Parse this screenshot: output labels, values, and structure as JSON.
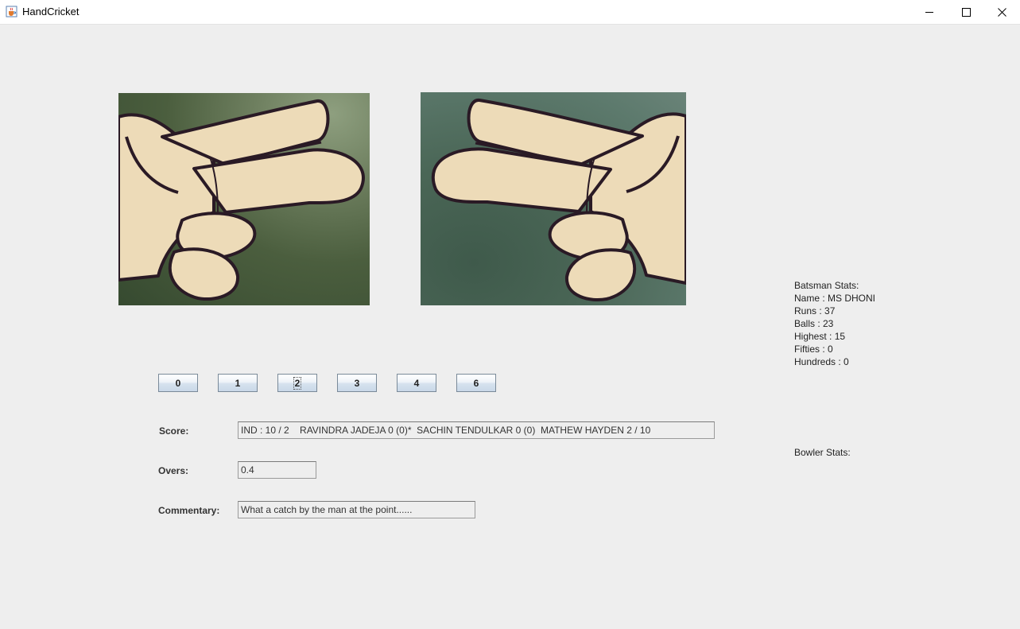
{
  "window": {
    "title": "HandCricket",
    "icon": "java-cup-icon"
  },
  "buttons": [
    "0",
    "1",
    "2",
    "3",
    "4",
    "6"
  ],
  "focused_button": "2",
  "labels": {
    "score": "Score:",
    "overs": "Overs:",
    "commentary": "Commentary:"
  },
  "fields": {
    "score": "IND : 10 / 2    RAVINDRA JADEJA 0 (0)*  SACHIN TENDULKAR 0 (0)  MATHEW HAYDEN 2 / 10",
    "overs": "0.4",
    "commentary": "What a catch by the man at the point......"
  },
  "batsman_stats": {
    "heading": "Batsman Stats:",
    "name": "Name : MS DHONI",
    "runs": "Runs : 37",
    "balls": "Balls : 23",
    "highest": "Highest : 15",
    "fifties": "Fifties : 0",
    "hundreds": "Hundreds : 0"
  },
  "bowler_stats": {
    "heading": "Bowler Stats:"
  },
  "images": {
    "left_hand": "hand-showing-two-fingers",
    "right_hand": "hand-showing-two-fingers"
  },
  "colors": {
    "skin": "#eddbb8",
    "outline": "#2a1a25",
    "button_border": "#7a8a99"
  }
}
